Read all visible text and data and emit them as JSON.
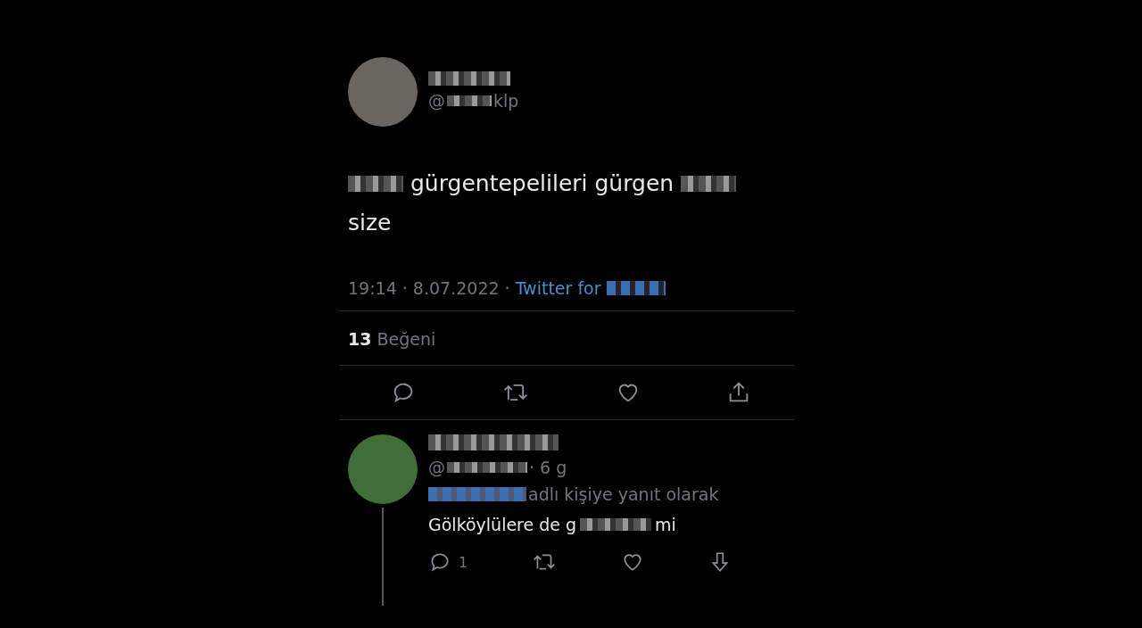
{
  "tweet": {
    "handle_prefix": "@",
    "handle_suffix": "klp",
    "text_line_1": "gürgentepelileri gürgen",
    "text_line_2": "size",
    "timestamp": "19:14 · 8.07.2022 ·",
    "source": "Twitter for",
    "like_count": "13",
    "like_label": "Beğeni"
  },
  "reply": {
    "handle_prefix": "@",
    "age": "· 6 g",
    "reply_to": "adlı kişiye yanıt olarak",
    "text_start": "Gölköylülere de g",
    "text_end": "mi",
    "reply_count": "1"
  }
}
